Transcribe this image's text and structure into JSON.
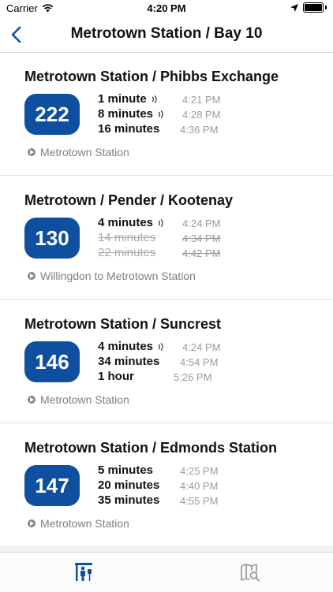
{
  "status_bar": {
    "carrier": "Carrier",
    "time": "4:20 PM"
  },
  "nav": {
    "title": "Metrotown Station / Bay 10"
  },
  "routes": [
    {
      "number": "222",
      "title": "Metrotown Station / Phibbs Exchange",
      "destination": "Metrotown Station",
      "arrivals": [
        {
          "eta": "1 minute",
          "clock": "4:21 PM",
          "realtime": true,
          "cancelled": false
        },
        {
          "eta": "8 minutes",
          "clock": "4:28 PM",
          "realtime": true,
          "cancelled": false
        },
        {
          "eta": "16 minutes",
          "clock": "4:36 PM",
          "realtime": false,
          "cancelled": false
        }
      ]
    },
    {
      "number": "130",
      "title": "Metrotown / Pender / Kootenay",
      "destination": "Willingdon to Metrotown Station",
      "arrivals": [
        {
          "eta": "4 minutes",
          "clock": "4:24 PM",
          "realtime": true,
          "cancelled": false
        },
        {
          "eta": "14 minutes",
          "clock": "4:34 PM",
          "realtime": false,
          "cancelled": true
        },
        {
          "eta": "22 minutes",
          "clock": "4:42 PM",
          "realtime": false,
          "cancelled": true
        }
      ]
    },
    {
      "number": "146",
      "title": "Metrotown Station / Suncrest",
      "destination": "Metrotown Station",
      "arrivals": [
        {
          "eta": "4 minutes",
          "clock": "4:24 PM",
          "realtime": true,
          "cancelled": false
        },
        {
          "eta": "34 minutes",
          "clock": "4:54 PM",
          "realtime": false,
          "cancelled": false
        },
        {
          "eta": "1 hour",
          "clock": "5:26 PM",
          "realtime": false,
          "cancelled": false
        }
      ]
    },
    {
      "number": "147",
      "title": "Metrotown Station / Edmonds Station",
      "destination": "Metrotown Station",
      "arrivals": [
        {
          "eta": "5 minutes",
          "clock": "4:25 PM",
          "realtime": false,
          "cancelled": false
        },
        {
          "eta": "20 minutes",
          "clock": "4:40 PM",
          "realtime": false,
          "cancelled": false
        },
        {
          "eta": "35 minutes",
          "clock": "4:55 PM",
          "realtime": false,
          "cancelled": false
        }
      ]
    }
  ],
  "tabs": [
    {
      "icon": "bus-stop-icon",
      "active": true
    },
    {
      "icon": "map-search-icon",
      "active": false
    }
  ],
  "colors": {
    "accent": "#0f4fa0",
    "badge_text": "#ffffff",
    "muted": "#9a9a9a"
  }
}
